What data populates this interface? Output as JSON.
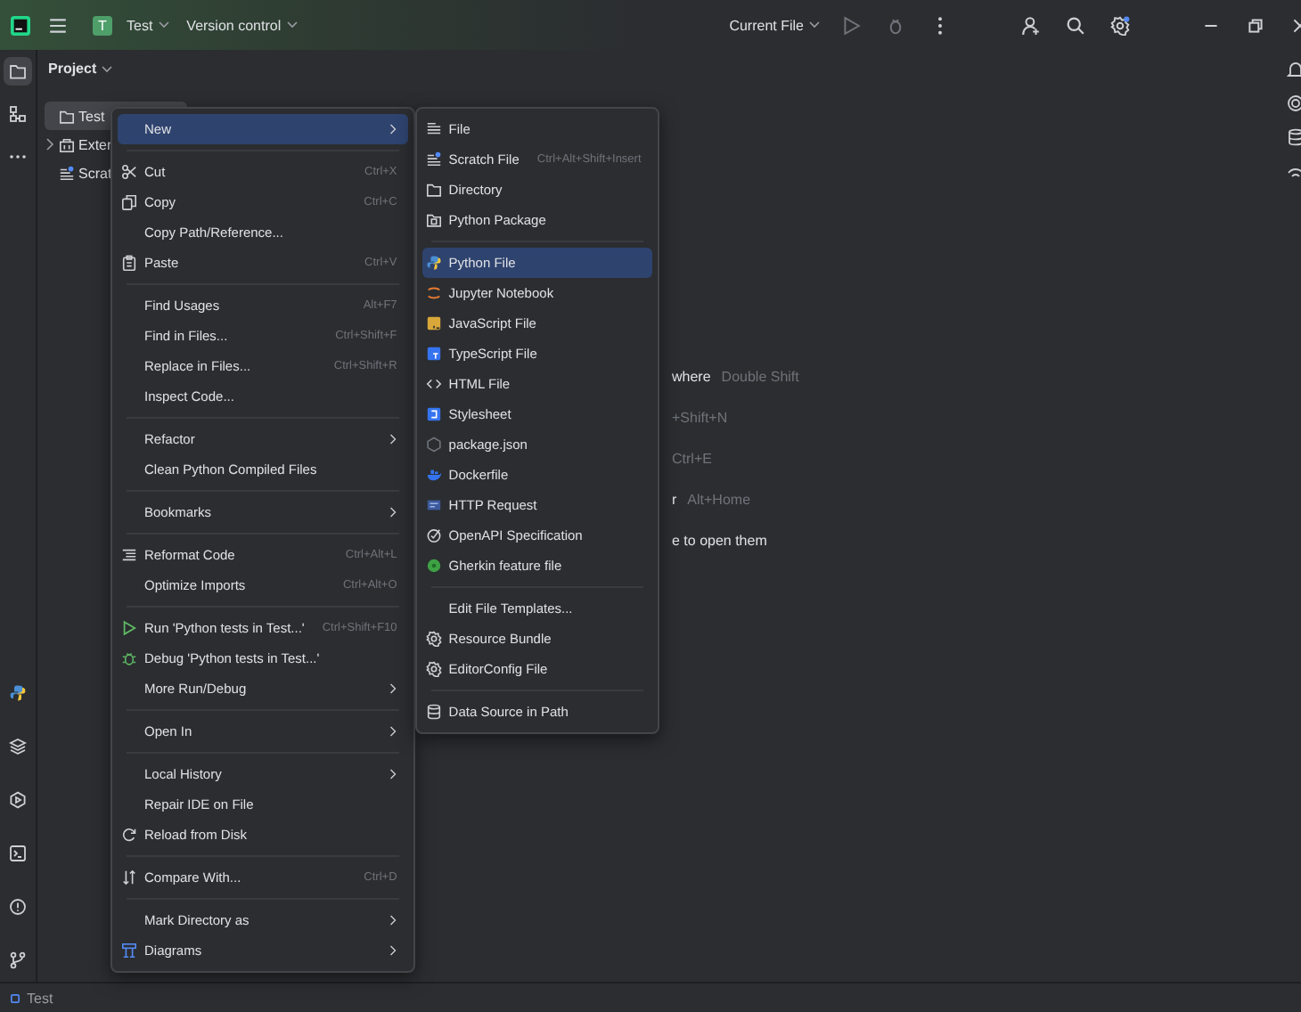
{
  "title_bar": {
    "project_badge": "T",
    "project": "Test",
    "vcs": "Version control",
    "run_config": "Current File"
  },
  "left_toolbar": {
    "top": [
      {
        "selected": true
      },
      {
        "selected": false
      },
      {
        "selected": false
      }
    ],
    "bottom": [
      {
        "selected": false
      },
      {
        "selected": false
      },
      {
        "selected": false
      },
      {
        "selected": false
      },
      {
        "selected": false
      },
      {
        "selected": false
      }
    ]
  },
  "project_panel": {
    "title": "Project",
    "tree": [
      {
        "label": "Test",
        "expandable": false,
        "selected": true
      },
      {
        "label": "Exter",
        "expandable": true,
        "selected": false
      },
      {
        "label": "Scrat",
        "expandable": false,
        "selected": false
      }
    ]
  },
  "editor_hints": [
    {
      "label": "where",
      "shortcut": "Double Shift"
    },
    {
      "shortcut": "+Shift+N"
    },
    {
      "shortcut": "Ctrl+E"
    },
    {
      "label": "r",
      "shortcut": "Alt+Home"
    },
    {
      "label": "e to open them"
    }
  ],
  "context_menu": {
    "groups": [
      [
        {
          "label": "New",
          "submenu": true,
          "selected": true
        }
      ],
      [
        {
          "label": "Cut",
          "shortcut": "Ctrl+X",
          "selected": false
        },
        {
          "label": "Copy",
          "shortcut": "Ctrl+C",
          "selected": false
        },
        {
          "label": "Copy Path/Reference...",
          "selected": false
        },
        {
          "label": "Paste",
          "shortcut": "Ctrl+V",
          "selected": false
        }
      ],
      [
        {
          "label": "Find Usages",
          "shortcut": "Alt+F7",
          "selected": false
        },
        {
          "label": "Find in Files...",
          "shortcut": "Ctrl+Shift+F",
          "selected": false
        },
        {
          "label": "Replace in Files...",
          "shortcut": "Ctrl+Shift+R",
          "selected": false
        },
        {
          "label": "Inspect Code...",
          "selected": false
        }
      ],
      [
        {
          "label": "Refactor",
          "submenu": true,
          "selected": false
        },
        {
          "label": "Clean Python Compiled Files",
          "selected": false
        }
      ],
      [
        {
          "label": "Bookmarks",
          "submenu": true,
          "selected": false
        }
      ],
      [
        {
          "label": "Reformat Code",
          "shortcut": "Ctrl+Alt+L",
          "selected": false
        },
        {
          "label": "Optimize Imports",
          "shortcut": "Ctrl+Alt+O",
          "selected": false
        }
      ],
      [
        {
          "label": "Run 'Python tests in Test...'",
          "shortcut": "Ctrl+Shift+F10",
          "selected": false
        },
        {
          "label": "Debug 'Python tests in Test...'",
          "selected": false
        },
        {
          "label": "More Run/Debug",
          "submenu": true,
          "selected": false
        }
      ],
      [
        {
          "label": "Open In",
          "submenu": true,
          "selected": false
        }
      ],
      [
        {
          "label": "Local History",
          "submenu": true,
          "selected": false
        },
        {
          "label": "Repair IDE on File",
          "selected": false
        },
        {
          "label": "Reload from Disk",
          "selected": false
        }
      ],
      [
        {
          "label": "Compare With...",
          "shortcut": "Ctrl+D",
          "selected": false
        }
      ],
      [
        {
          "label": "Mark Directory as",
          "submenu": true,
          "selected": false
        },
        {
          "label": "Diagrams",
          "submenu": true,
          "selected": false
        }
      ]
    ]
  },
  "new_submenu": {
    "groups": [
      [
        {
          "label": "File",
          "selected": false
        },
        {
          "label": "Scratch File",
          "shortcut": "Ctrl+Alt+Shift+Insert",
          "selected": false
        },
        {
          "label": "Directory",
          "selected": false
        },
        {
          "label": "Python Package",
          "selected": false
        }
      ],
      [
        {
          "label": "Python File",
          "selected": true
        },
        {
          "label": "Jupyter Notebook",
          "selected": false
        },
        {
          "label": "JavaScript File",
          "selected": false
        },
        {
          "label": "TypeScript File",
          "selected": false
        },
        {
          "label": "HTML File",
          "selected": false
        },
        {
          "label": "Stylesheet",
          "selected": false
        },
        {
          "label": "package.json",
          "selected": false
        },
        {
          "label": "Dockerfile",
          "selected": false
        },
        {
          "label": "HTTP Request",
          "selected": false
        },
        {
          "label": "OpenAPI Specification",
          "selected": false
        },
        {
          "label": "Gherkin feature file",
          "selected": false
        }
      ],
      [
        {
          "label": "Edit File Templates...",
          "selected": false
        },
        {
          "label": "Resource Bundle",
          "selected": false
        },
        {
          "label": "EditorConfig File",
          "selected": false
        }
      ],
      [
        {
          "label": "Data Source in Path",
          "selected": false
        }
      ]
    ]
  },
  "status_bar": {
    "project": "Test"
  }
}
